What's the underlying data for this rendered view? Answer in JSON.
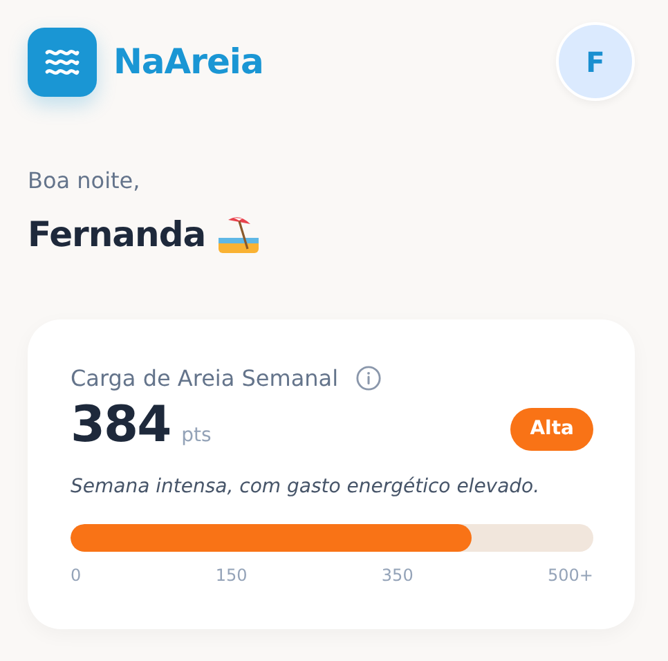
{
  "brand": {
    "name": "NaAreia"
  },
  "avatar": {
    "initial": "F"
  },
  "greeting": {
    "salutation": "Boa noite,",
    "name": "Fernanda"
  },
  "load_card": {
    "title": "Carga de Areia Semanal",
    "value": "384",
    "unit": "pts",
    "badge": "Alta",
    "description": "Semana intensa, com gasto energético elevado.",
    "level": 0.767,
    "scale": [
      "0",
      "150",
      "350",
      "500+"
    ]
  }
}
